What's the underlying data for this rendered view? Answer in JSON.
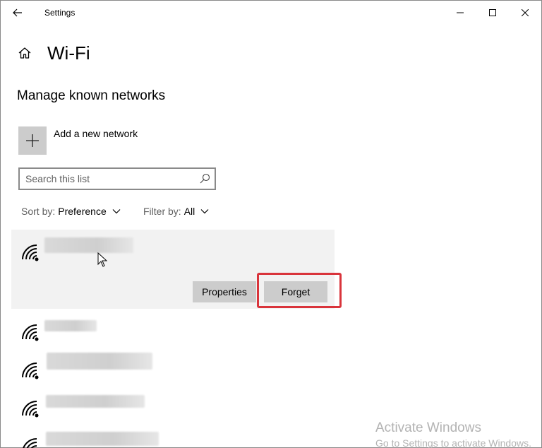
{
  "window": {
    "title": "Settings"
  },
  "page": {
    "title": "Wi-Fi",
    "section_title": "Manage known networks"
  },
  "add_network": {
    "label": "Add a new network"
  },
  "search": {
    "placeholder": "Search this list",
    "value": ""
  },
  "sort": {
    "label": "Sort by:",
    "value": "Preference"
  },
  "filter": {
    "label": "Filter by:",
    "value": "All"
  },
  "networks": {
    "selected": {
      "name_obscured": true
    },
    "properties_label": "Properties",
    "forget_label": "Forget",
    "list_count_visible": 4
  },
  "colors": {
    "selected_bg": "#f2f2f2",
    "button_bg": "#cccccc",
    "highlight_border": "#d9343b",
    "watermark_text": "#b3b3b3"
  },
  "icons": {
    "back": "arrow-left-icon",
    "home": "home-icon",
    "add": "plus-icon",
    "search": "search-icon",
    "chevron": "chevron-down-icon",
    "wifi": "wifi-secured-icon"
  },
  "watermark": {
    "title": "Activate Windows",
    "subtitle": "Go to Settings to activate Windows."
  }
}
